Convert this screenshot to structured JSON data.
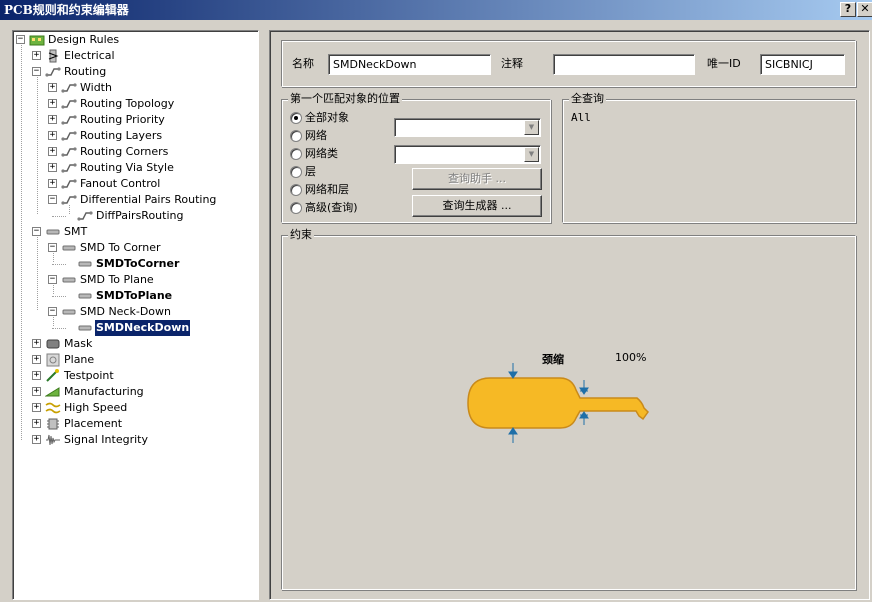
{
  "window": {
    "title": "PCB规则和约束编辑器",
    "help_btn": "?",
    "close_btn": "✕"
  },
  "tree": [
    {
      "label": "Design Rules",
      "icon": "design-rules-icon",
      "expander": "⊟"
    },
    {
      "label": "Electrical",
      "icon": "electrical-icon",
      "expander": "+"
    },
    {
      "label": "Routing",
      "icon": "routing-icon",
      "expander": "−"
    },
    {
      "label": "Width",
      "icon": "routing-rule-icon",
      "expander": "+"
    },
    {
      "label": "Routing Topology",
      "icon": "routing-rule-icon",
      "expander": "+"
    },
    {
      "label": "Routing Priority",
      "icon": "routing-rule-icon",
      "expander": "+"
    },
    {
      "label": "Routing Layers",
      "icon": "routing-rule-icon",
      "expander": "+"
    },
    {
      "label": "Routing Corners",
      "icon": "routing-rule-icon",
      "expander": "+"
    },
    {
      "label": "Routing Via Style",
      "icon": "routing-rule-icon",
      "expander": "+"
    },
    {
      "label": "Fanout Control",
      "icon": "routing-rule-icon",
      "expander": "+"
    },
    {
      "label": "Differential Pairs Routing",
      "icon": "routing-rule-icon",
      "expander": "−"
    },
    {
      "label": "DiffPairsRouting",
      "icon": "routing-rule-icon",
      "expander": ""
    },
    {
      "label": "SMT",
      "icon": "smt-icon",
      "expander": "−"
    },
    {
      "label": "SMD To Corner",
      "icon": "smt-rule-icon",
      "expander": "−"
    },
    {
      "label": "SMDToCorner",
      "icon": "smt-rule-icon",
      "expander": ""
    },
    {
      "label": "SMD To Plane",
      "icon": "smt-rule-icon",
      "expander": "−"
    },
    {
      "label": "SMDToPlane",
      "icon": "smt-rule-icon",
      "expander": ""
    },
    {
      "label": "SMD Neck-Down",
      "icon": "smt-rule-icon",
      "expander": "−"
    },
    {
      "label": "SMDNeckDown",
      "icon": "smt-rule-icon",
      "expander": ""
    },
    {
      "label": "Mask",
      "icon": "mask-icon",
      "expander": "+"
    },
    {
      "label": "Plane",
      "icon": "plane-icon",
      "expander": "+"
    },
    {
      "label": "Testpoint",
      "icon": "testpoint-icon",
      "expander": "+"
    },
    {
      "label": "Manufacturing",
      "icon": "manufacturing-icon",
      "expander": "+"
    },
    {
      "label": "High Speed",
      "icon": "high-speed-icon",
      "expander": "+"
    },
    {
      "label": "Placement",
      "icon": "placement-icon",
      "expander": "+"
    },
    {
      "label": "Signal Integrity",
      "icon": "signal-integrity-icon",
      "expander": "+"
    }
  ],
  "rule": {
    "name_label": "名称",
    "name_value": "SMDNeckDown",
    "comment_label": "注释",
    "comment_value": "",
    "uid_label": "唯一ID",
    "uid_value": "SICBNICJ"
  },
  "first_match": {
    "title": "第一个匹配对象的位置",
    "options": [
      "全部对象",
      "网络",
      "网络类",
      "层",
      "网络和层",
      "高级(查询)"
    ],
    "selected": "全部对象",
    "query_helper": "查询助手 ...",
    "query_builder": "查询生成器 ..."
  },
  "full_query": {
    "title": "全查询",
    "text": "All"
  },
  "constraints": {
    "title": "约束",
    "neckdown_label": "颈缩",
    "neckdown_value": "100%"
  },
  "colors": {
    "pad_fill": "#f6b925",
    "pad_stroke": "#c98a1a",
    "arrow": "#1f6fa8",
    "selection": "#0a246a"
  }
}
